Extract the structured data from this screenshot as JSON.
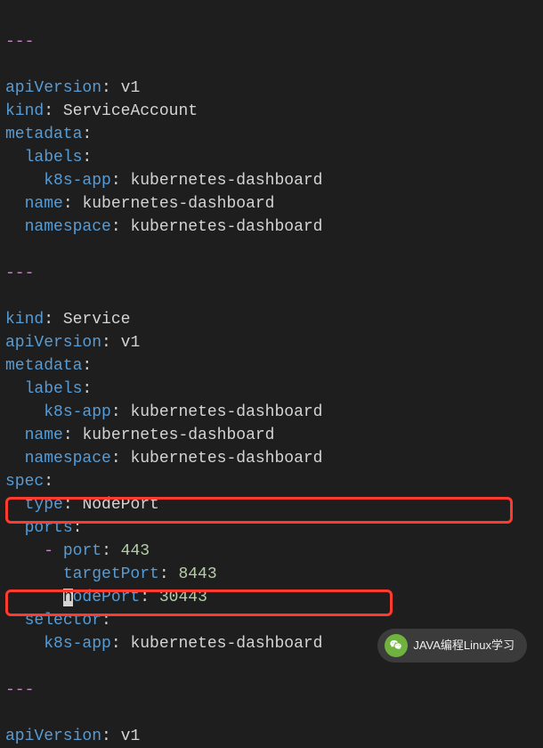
{
  "chart_data": {
    "type": "table",
    "title": "Kubernetes YAML manifest snippet",
    "sections": [
      {
        "divider": "---"
      },
      {
        "apiVersion": "v1",
        "kind": "ServiceAccount",
        "metadata": {
          "labels": {
            "k8s-app": "kubernetes-dashboard"
          },
          "name": "kubernetes-dashboard",
          "namespace": "kubernetes-dashboard"
        }
      },
      {
        "divider": "---"
      },
      {
        "kind": "Service",
        "apiVersion": "v1",
        "metadata": {
          "labels": {
            "k8s-app": "kubernetes-dashboard"
          },
          "name": "kubernetes-dashboard",
          "namespace": "kubernetes-dashboard"
        },
        "spec": {
          "type": "NodePort",
          "ports": [
            {
              "port": 443,
              "targetPort": 8443,
              "nodePort": 30443
            }
          ],
          "selector": {
            "k8s-app": "kubernetes-dashboard"
          }
        }
      },
      {
        "divider": "---"
      },
      {
        "apiVersion": "v1"
      }
    ]
  },
  "code": {
    "dash1": "---",
    "sa": {
      "apiVersion_k": "apiVersion",
      "apiVersion_v": "v1",
      "kind_k": "kind",
      "kind_v": "ServiceAccount",
      "metadata_k": "metadata",
      "labels_k": "labels",
      "k8sapp_k": "k8s-app",
      "k8sapp_v": "kubernetes-dashboard",
      "name_k": "name",
      "name_v": "kubernetes-dashboard",
      "ns_k": "namespace",
      "ns_v": "kubernetes-dashboard"
    },
    "dash2": "---",
    "svc": {
      "kind_k": "kind",
      "kind_v": "Service",
      "apiVersion_k": "apiVersion",
      "apiVersion_v": "v1",
      "metadata_k": "metadata",
      "labels_k": "labels",
      "k8sapp_k": "k8s-app",
      "k8sapp_v": "kubernetes-dashboard",
      "name_k": "name",
      "name_v": "kubernetes-dashboard",
      "ns_k": "namespace",
      "ns_v": "kubernetes-dashboard",
      "spec_k": "spec",
      "type_k": "type",
      "type_v": "NodePort",
      "ports_k": "ports",
      "port_k": "port",
      "port_v": "443",
      "tp_k": "targetPort",
      "tp_v": "8443",
      "np_k_first": "n",
      "np_k_rest": "odePort",
      "np_v": "30443",
      "sel_k": "selector",
      "sel_k8sapp_k": "k8s-app",
      "sel_k8sapp_v": "kubernetes-dashboard"
    },
    "dash3": "---",
    "last": {
      "apiVersion_k": "apiVersion",
      "apiVersion_v": "v1"
    }
  },
  "watermark": {
    "text": "JAVA编程Linux学习"
  }
}
